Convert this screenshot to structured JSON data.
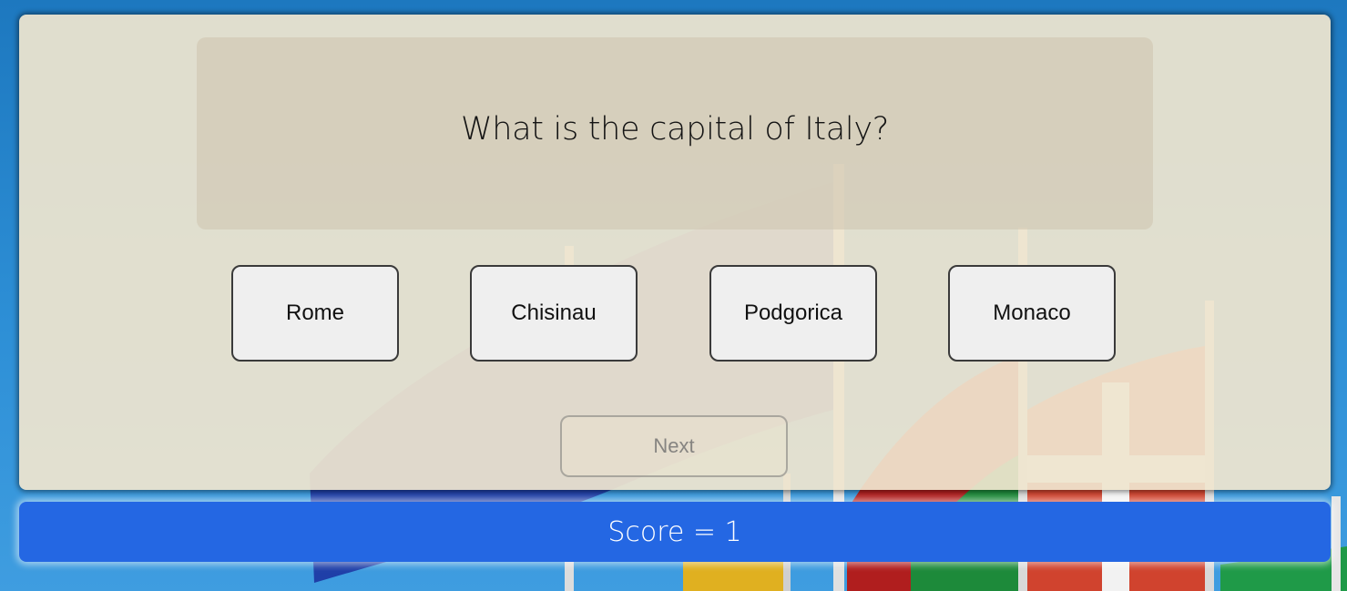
{
  "quiz": {
    "question": "What is the capital of Italy?",
    "answers": [
      "Rome",
      "Chisinau",
      "Podgorica",
      "Monaco"
    ],
    "next_label": "Next"
  },
  "score": {
    "text": "Score = 1"
  },
  "colors": {
    "card_background": "#efe5cf",
    "score_bar": "#2467e3",
    "answer_button": "#efefef"
  }
}
